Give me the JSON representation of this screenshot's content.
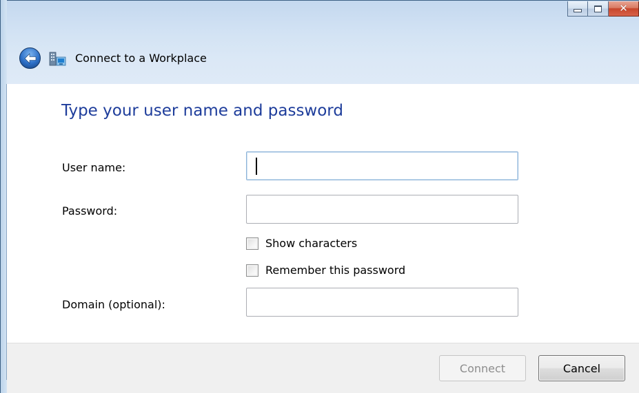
{
  "window": {
    "title": "Connect to a Workplace",
    "icons": {
      "back": "back-arrow-icon",
      "app": "network-workplace-icon",
      "minimize": "minimize-icon",
      "maximize": "maximize-icon",
      "close": "close-icon"
    },
    "close_glyph": "✕"
  },
  "form": {
    "heading": "Type your user name and password",
    "username_label": "User name:",
    "username_value": "",
    "password_label": "Password:",
    "password_value": "",
    "show_characters_label": "Show characters",
    "show_characters_checked": false,
    "remember_password_label": "Remember this password",
    "remember_password_checked": false,
    "domain_label": "Domain (optional):",
    "domain_value": ""
  },
  "footer": {
    "connect_label": "Connect",
    "connect_enabled": false,
    "cancel_label": "Cancel"
  },
  "colors": {
    "heading": "#1e3d9b",
    "close_button": "#c7462b",
    "back_button": "#2c6fc7"
  }
}
